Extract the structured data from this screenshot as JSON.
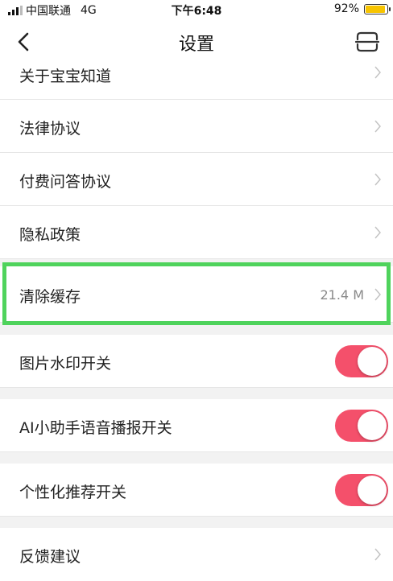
{
  "status_bar": {
    "carrier": "中国联通",
    "network": "4G",
    "time": "下午6:48",
    "battery_percent": "92%",
    "battery_level": 0.92
  },
  "nav": {
    "title": "设置",
    "back_icon": "chevron-left-icon",
    "scan_icon": "scan-icon"
  },
  "rows": [
    {
      "label": "关于宝宝知道",
      "type": "link"
    },
    {
      "label": "法律协议",
      "type": "link"
    },
    {
      "label": "付费问答协议",
      "type": "link"
    },
    {
      "label": "隐私政策",
      "type": "link"
    },
    {
      "label": "清除缓存",
      "type": "link",
      "value": "21.4 M"
    },
    {
      "label": "图片水印开关",
      "type": "toggle",
      "on": true
    },
    {
      "label": "AI小助手语音播报开关",
      "type": "toggle",
      "on": true
    },
    {
      "label": "个性化推荐开关",
      "type": "toggle",
      "on": true
    },
    {
      "label": "反馈建议",
      "type": "link"
    }
  ],
  "colors": {
    "toggle_on": "#f4506b",
    "highlight": "#4fd35c",
    "battery": "#f7c400"
  }
}
